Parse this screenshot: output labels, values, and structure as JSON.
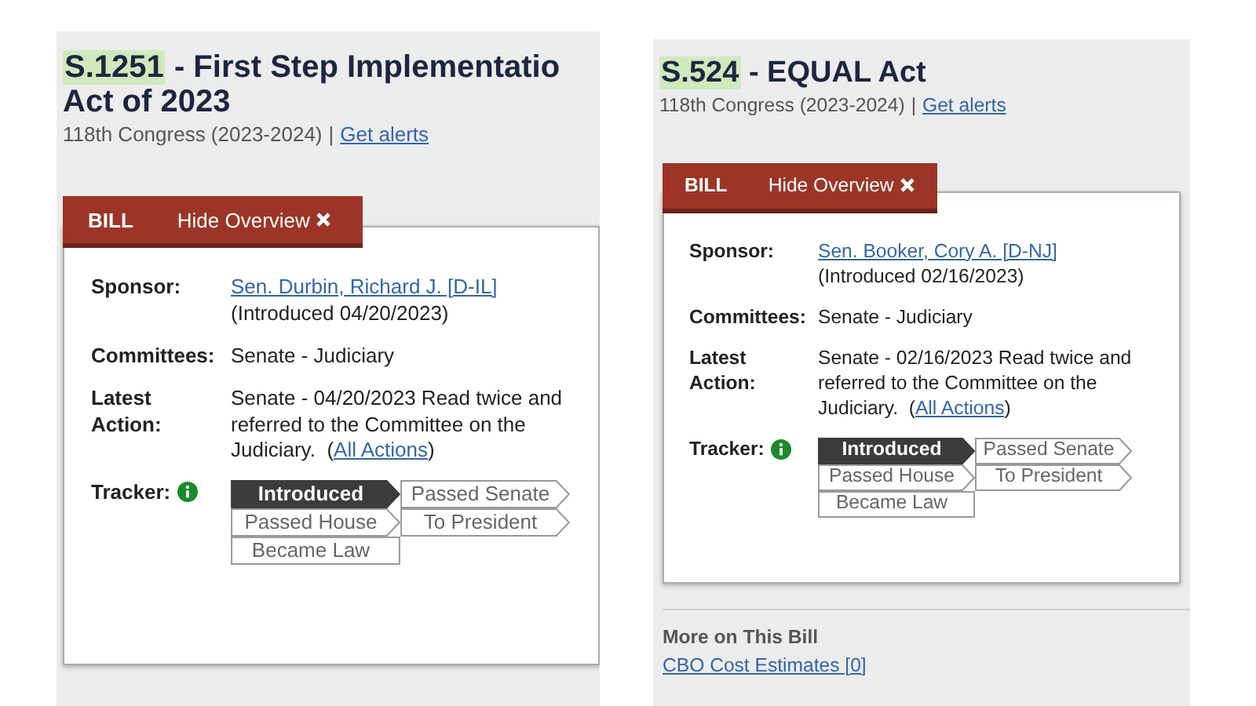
{
  "panels": [
    {
      "bill_number": "S.1251",
      "title_lines": [
        "- First Step Implementatio",
        "Act of 2023"
      ],
      "congress": "118th Congress (2023-2024)",
      "separator": "|",
      "alerts_link": "Get alerts",
      "bill_tab": "BILL",
      "hide_overview": "Hide Overview",
      "sponsor_label": "Sponsor:",
      "sponsor_link": "Sen. Durbin, Richard J. [D-IL]",
      "introduced": "(Introduced 04/20/2023)",
      "committees_label": "Committees:",
      "committees": "Senate - Judiciary",
      "latest_action_label": "Latest Action:",
      "latest_action": "Senate - 04/20/2023 Read twice and referred to the Committee on the Judiciary.",
      "actions_open": "(",
      "actions_link": "All Actions",
      "actions_close": ")",
      "tracker_label": "Tracker:",
      "tracker_steps": [
        {
          "label": "Introduced",
          "selected": true,
          "kind": "arrow"
        },
        {
          "label": "Passed Senate",
          "selected": false,
          "kind": "arrow"
        },
        {
          "label": "Passed House",
          "selected": false,
          "kind": "arrow"
        },
        {
          "label": "To President",
          "selected": false,
          "kind": "arrow"
        },
        {
          "label": "Became Law",
          "selected": false,
          "kind": "box"
        }
      ]
    },
    {
      "bill_number": "S.524",
      "title_lines": [
        "- EQUAL Act"
      ],
      "congress": "118th Congress (2023-2024)",
      "separator": "|",
      "alerts_link": "Get alerts",
      "bill_tab": "BILL",
      "hide_overview": "Hide Overview",
      "sponsor_label": "Sponsor:",
      "sponsor_link": "Sen. Booker, Cory A. [D-NJ]",
      "introduced": "(Introduced 02/16/2023)",
      "committees_label": "Committees:",
      "committees": "Senate - Judiciary",
      "latest_action_label": "Latest Action:",
      "latest_action": "Senate - 02/16/2023 Read twice and referred to the Committee on the Judiciary.",
      "actions_open": "(",
      "actions_link": "All Actions",
      "actions_close": ")",
      "tracker_label": "Tracker:",
      "tracker_steps": [
        {
          "label": "Introduced",
          "selected": true,
          "kind": "arrow"
        },
        {
          "label": "Passed Senate",
          "selected": false,
          "kind": "arrow"
        },
        {
          "label": "Passed House",
          "selected": false,
          "kind": "arrow"
        },
        {
          "label": "To President",
          "selected": false,
          "kind": "arrow"
        },
        {
          "label": "Became Law",
          "selected": false,
          "kind": "box"
        }
      ],
      "more_heading": "More on This Bill",
      "more_links": [
        "CBO Cost Estimates [0]"
      ]
    }
  ]
}
